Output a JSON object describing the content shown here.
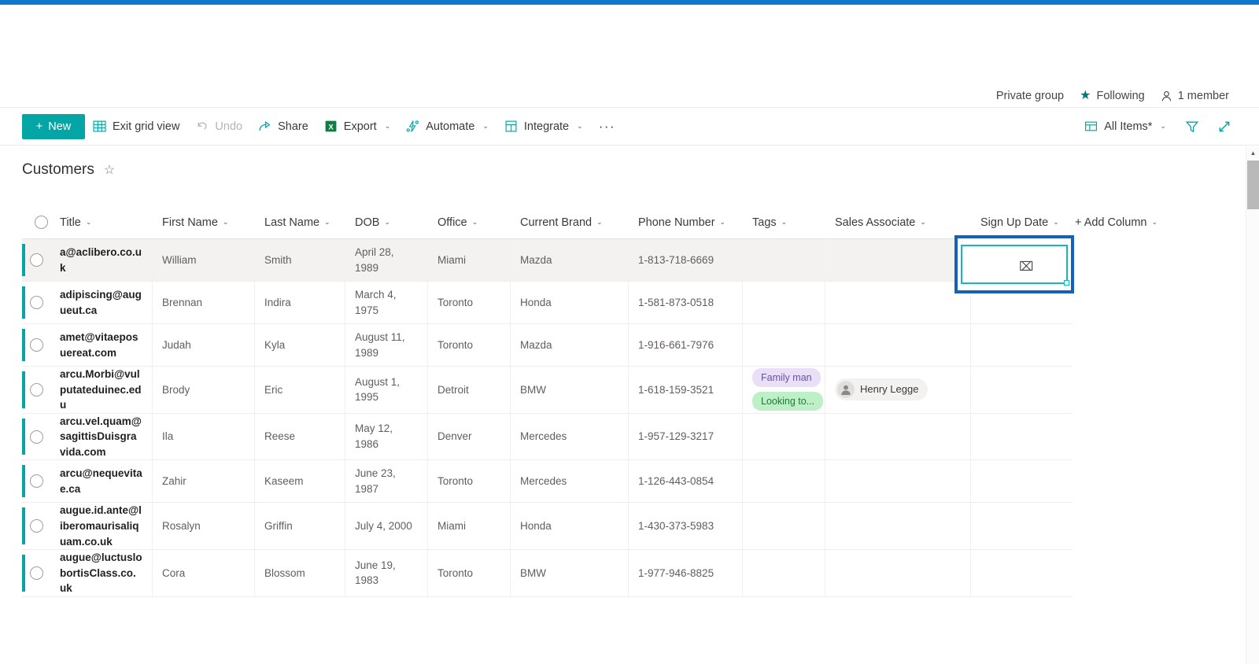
{
  "site": {
    "privacy_label": "Private group",
    "following_label": "Following",
    "members_label": "1 member"
  },
  "commandbar": {
    "new_label": "New",
    "exit_grid_label": "Exit grid view",
    "undo_label": "Undo",
    "share_label": "Share",
    "export_label": "Export",
    "automate_label": "Automate",
    "integrate_label": "Integrate",
    "overflow_label": "···",
    "view_label": "All Items*",
    "chevron": "⌄"
  },
  "list": {
    "title": "Customers",
    "favorite_icon": "☆",
    "columns": [
      {
        "label": "Title",
        "key": "title"
      },
      {
        "label": "First Name",
        "key": "first"
      },
      {
        "label": "Last Name",
        "key": "last"
      },
      {
        "label": "DOB",
        "key": "dob"
      },
      {
        "label": "Office",
        "key": "office"
      },
      {
        "label": "Current Brand",
        "key": "brand"
      },
      {
        "label": "Phone Number",
        "key": "phone"
      },
      {
        "label": "Tags",
        "key": "tags"
      },
      {
        "label": "Sales Associate",
        "key": "sales"
      },
      {
        "label": "Sign Up Date",
        "key": "signup"
      }
    ],
    "add_column_label": "+ Add Column",
    "rows": [
      {
        "title": "a@aclibero.co.uk",
        "first": "William",
        "last": "Smith",
        "dob": "April 28, 1989",
        "office": "Miami",
        "brand": "Mazda",
        "phone": "1-813-718-6669",
        "tags": [],
        "sales": "",
        "signup": ""
      },
      {
        "title": "adipiscing@augueut.ca",
        "first": "Brennan",
        "last": "Indira",
        "dob": "March 4, 1975",
        "office": "Toronto",
        "brand": "Honda",
        "phone": "1-581-873-0518",
        "tags": [],
        "sales": "",
        "signup": ""
      },
      {
        "title": "amet@vitaeposuereat.com",
        "first": "Judah",
        "last": "Kyla",
        "dob": "August 11, 1989",
        "office": "Toronto",
        "brand": "Mazda",
        "phone": "1-916-661-7976",
        "tags": [],
        "sales": "",
        "signup": ""
      },
      {
        "title": "arcu.Morbi@vulputateduinec.edu",
        "first": "Brody",
        "last": "Eric",
        "dob": "August 1, 1995",
        "office": "Detroit",
        "brand": "BMW",
        "phone": "1-618-159-3521",
        "tags": [
          {
            "label": "Family man",
            "color": "purple"
          },
          {
            "label": "Looking to...",
            "color": "green"
          }
        ],
        "sales": "Henry Legge",
        "signup": ""
      },
      {
        "title": "arcu.vel.quam@sagittisDuisgravida.com",
        "first": "Ila",
        "last": "Reese",
        "dob": "May 12, 1986",
        "office": "Denver",
        "brand": "Mercedes",
        "phone": "1-957-129-3217",
        "tags": [],
        "sales": "",
        "signup": ""
      },
      {
        "title": "arcu@nequevitae.ca",
        "first": "Zahir",
        "last": "Kaseem",
        "dob": "June 23, 1987",
        "office": "Toronto",
        "brand": "Mercedes",
        "phone": "1-126-443-0854",
        "tags": [],
        "sales": "",
        "signup": ""
      },
      {
        "title": "augue.id.ante@liberomaurisaliquam.co.uk",
        "first": "Rosalyn",
        "last": "Griffin",
        "dob": "July 4, 2000",
        "office": "Miami",
        "brand": "Honda",
        "phone": "1-430-373-5983",
        "tags": [],
        "sales": "",
        "signup": ""
      },
      {
        "title": "augue@luctuslobortisClass.co.uk",
        "first": "Cora",
        "last": "Blossom",
        "dob": "June 19, 1983",
        "office": "Toronto",
        "brand": "BMW",
        "phone": "1-977-946-8825",
        "tags": [],
        "sales": "",
        "signup": ""
      }
    ],
    "active_cell": {
      "row": 0,
      "column": "Sign Up Date",
      "value": ""
    }
  },
  "colors": {
    "accent_teal": "#03a5a5",
    "focus_blue": "#1462b8",
    "cell_border_teal": "#18b6bd",
    "top_strip_blue": "#1177cc",
    "tag_purple_bg": "#e9dff7",
    "tag_green_bg": "#bdf0c7"
  }
}
